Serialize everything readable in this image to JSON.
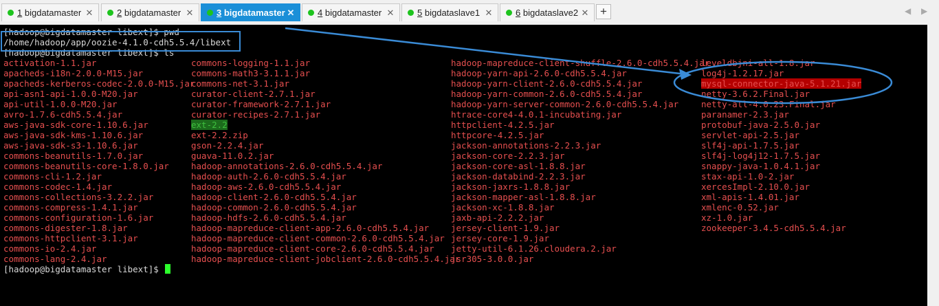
{
  "tabs": [
    {
      "num": "1",
      "name": "bigdatamaster",
      "active": false
    },
    {
      "num": "2",
      "name": "bigdatamaster",
      "active": false
    },
    {
      "num": "3",
      "name": "bigdatamaster",
      "active": true
    },
    {
      "num": "4",
      "name": "bigdatamaster",
      "active": false
    },
    {
      "num": "5",
      "name": "bigdataslave1",
      "active": false
    },
    {
      "num": "6",
      "name": "bigdataslave2",
      "active": false
    }
  ],
  "toolbar": {
    "add_tab": "+",
    "scroll_left": "◀",
    "scroll_right": "▶"
  },
  "terminal": {
    "lines": {
      "pwd_cmd": "[hadoop@bigdatamaster libext]$ pwd",
      "pwd_output": "/home/hadoop/app/oozie-4.1.0-cdh5.5.4/libext",
      "ls_cmd": "[hadoop@bigdatamaster libext]$ ls",
      "prompt": "[hadoop@bigdatamaster libext]$ "
    },
    "files": {
      "col1": [
        "activation-1.1.jar",
        "apacheds-i18n-2.0.0-M15.jar",
        "apacheds-kerberos-codec-2.0.0-M15.jar",
        "api-asn1-api-1.0.0-M20.jar",
        "api-util-1.0.0-M20.jar",
        "avro-1.7.6-cdh5.5.4.jar",
        "aws-java-sdk-core-1.10.6.jar",
        "aws-java-sdk-kms-1.10.6.jar",
        "aws-java-sdk-s3-1.10.6.jar",
        "commons-beanutils-1.7.0.jar",
        "commons-beanutils-core-1.8.0.jar",
        "commons-cli-1.2.jar",
        "commons-codec-1.4.jar",
        "commons-collections-3.2.2.jar",
        "commons-compress-1.4.1.jar",
        "commons-configuration-1.6.jar",
        "commons-digester-1.8.jar",
        "commons-httpclient-3.1.jar",
        "commons-io-2.4.jar",
        "commons-lang-2.4.jar"
      ],
      "col2": [
        "commons-logging-1.1.jar",
        "commons-math3-3.1.1.jar",
        "commons-net-3.1.jar",
        "curator-client-2.7.1.jar",
        "curator-framework-2.7.1.jar",
        "curator-recipes-2.7.1.jar",
        "ext-2.2",
        "ext-2.2.zip",
        "gson-2.2.4.jar",
        "guava-11.0.2.jar",
        "hadoop-annotations-2.6.0-cdh5.5.4.jar",
        "hadoop-auth-2.6.0-cdh5.5.4.jar",
        "hadoop-aws-2.6.0-cdh5.5.4.jar",
        "hadoop-client-2.6.0-cdh5.5.4.jar",
        "hadoop-common-2.6.0-cdh5.5.4.jar",
        "hadoop-hdfs-2.6.0-cdh5.5.4.jar",
        "hadoop-mapreduce-client-app-2.6.0-cdh5.5.4.jar",
        "hadoop-mapreduce-client-common-2.6.0-cdh5.5.4.jar",
        "hadoop-mapreduce-client-core-2.6.0-cdh5.5.4.jar",
        "hadoop-mapreduce-client-jobclient-2.6.0-cdh5.5.4.jar"
      ],
      "col3": [
        "hadoop-mapreduce-client-shuffle-2.6.0-cdh5.5.4.jar",
        "hadoop-yarn-api-2.6.0-cdh5.5.4.jar",
        "hadoop-yarn-client-2.6.0-cdh5.5.4.jar",
        "hadoop-yarn-common-2.6.0-cdh5.5.4.jar",
        "hadoop-yarn-server-common-2.6.0-cdh5.5.4.jar",
        "htrace-core4-4.0.1-incubating.jar",
        "httpclient-4.2.5.jar",
        "httpcore-4.2.5.jar",
        "jackson-annotations-2.2.3.jar",
        "jackson-core-2.2.3.jar",
        "jackson-core-asl-1.8.8.jar",
        "jackson-databind-2.2.3.jar",
        "jackson-jaxrs-1.8.8.jar",
        "jackson-mapper-asl-1.8.8.jar",
        "jackson-xc-1.8.8.jar",
        "jaxb-api-2.2.2.jar",
        "jersey-client-1.9.jar",
        "jersey-core-1.9.jar",
        "jetty-util-6.1.26.cloudera.2.jar",
        "jsr305-3.0.0.jar"
      ],
      "col4": [
        "leveldbjni-all-1.8.jar",
        "log4j-1.2.17.jar",
        "mysql-connector-java-5.1.21.jar",
        "netty-3.6.2.Final.jar",
        "netty-all-4.0.23.Final.jar",
        "paranamer-2.3.jar",
        "protobuf-java-2.5.0.jar",
        "servlet-api-2.5.jar",
        "slf4j-api-1.7.5.jar",
        "slf4j-log4j12-1.7.5.jar",
        "snappy-java-1.0.4.1.jar",
        "stax-api-1.0-2.jar",
        "xercesImpl-2.10.0.jar",
        "xml-apis-1.4.01.jar",
        "xmlenc-0.52.jar",
        "xz-1.0.jar",
        "zookeeper-3.4.5-cdh5.5.4.jar"
      ]
    },
    "highlighted_file": "mysql-connector-java-5.1.21.jar",
    "directory_entry": "ext-2.2"
  },
  "colors": {
    "file": "#e64f4f",
    "directory_bg": "#1c6b1c",
    "highlight_bg": "#b40000",
    "annotation": "#3a8bd6",
    "active_tab": "#1a8fd8",
    "status_dot": "#1ec41e",
    "cursor": "#2cff2c"
  }
}
